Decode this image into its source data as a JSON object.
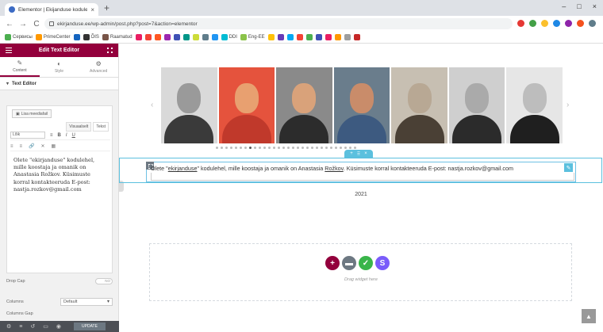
{
  "browser": {
    "tab_title": "Elementor | Ekijanduse kodulehe",
    "tab_close": "×",
    "new_tab": "+",
    "url": "ekirjanduse.ee/wp-admin/post.php?post=7&action=elementor",
    "back": "←",
    "forward": "→",
    "reload": "C",
    "window_controls": [
      "–",
      "□",
      "×"
    ],
    "extension_colors": [
      "#e53935",
      "#43a047",
      "#fbc02d",
      "#1e88e5",
      "#8e24aa",
      "#f4511e",
      "#607d8b"
    ]
  },
  "bookmarks": [
    {
      "label": "Сервисы",
      "color": "#4caf50"
    },
    {
      "label": "PrimeCenter",
      "color": "#ff9800"
    },
    {
      "label": "",
      "color": "#1565c0"
    },
    {
      "label": "ÕIS",
      "color": "#333333"
    },
    {
      "label": "Raamatud",
      "color": "#795548"
    },
    {
      "label": "",
      "color": "#e91e63"
    },
    {
      "label": "",
      "color": "#f44336"
    },
    {
      "label": "",
      "color": "#ff5722"
    },
    {
      "label": "",
      "color": "#9c27b0"
    },
    {
      "label": "",
      "color": "#3f51b5"
    },
    {
      "label": "",
      "color": "#009688"
    },
    {
      "label": "",
      "color": "#cddc39"
    },
    {
      "label": "",
      "color": "#607d8b"
    },
    {
      "label": "",
      "color": "#2196f3"
    },
    {
      "label": "DDI",
      "color": "#00bcd4"
    },
    {
      "label": "Eng-EE",
      "color": "#8bc34a"
    },
    {
      "label": "",
      "color": "#ffc107"
    },
    {
      "label": "",
      "color": "#673ab7"
    },
    {
      "label": "",
      "color": "#03a9f4"
    },
    {
      "label": "",
      "color": "#f44336"
    },
    {
      "label": "",
      "color": "#4caf50"
    },
    {
      "label": "",
      "color": "#3f51b5"
    },
    {
      "label": "",
      "color": "#e91e63"
    },
    {
      "label": "",
      "color": "#ff9800"
    },
    {
      "label": "",
      "color": "#9e9e9e"
    },
    {
      "label": "",
      "color": "#c62828"
    }
  ],
  "panel": {
    "title": "Edit Text Editor",
    "tabs": [
      {
        "label": "Content",
        "icon": "✎"
      },
      {
        "label": "Style",
        "icon": "◐"
      },
      {
        "label": "Advanced",
        "icon": "⚙"
      }
    ],
    "section": "Text Editor",
    "add_media": "Lisa meediafail",
    "mode_tabs": [
      "Visuaalselt",
      "Tekst"
    ],
    "format": "Lõik",
    "toolbar1": [
      "≡",
      "B",
      "I",
      "U"
    ],
    "toolbar2": [
      "≡",
      "≡",
      "🔗",
      "✕",
      "▦"
    ],
    "editor_text": "Olete \"ekirjanduse\" kodulehel, mille koostaja ja omanik on Anastasia Rožkov. Küsimuste korral kontakteeruda E-post: nastja.rozkov@gmail.com",
    "drop_cap_label": "Drop Cap",
    "drop_cap_value": "NO",
    "columns_label": "Columns",
    "columns_value": "Default",
    "columns_gap_label": "Columns Gap",
    "update_label": "UPDATE"
  },
  "preview": {
    "gallery": [
      {
        "name": "portrait-1",
        "head": "#9a9a9a",
        "body": "#3a3a3a",
        "bg": "#d9d9d9"
      },
      {
        "name": "portrait-2",
        "head": "#e8a070",
        "body": "#c0392b",
        "bg": "#e5533d"
      },
      {
        "name": "portrait-3",
        "head": "#d9a27a",
        "body": "#2c2c2c",
        "bg": "#8a8a8a"
      },
      {
        "name": "portrait-4",
        "head": "#c98c6a",
        "body": "#3d5a80",
        "bg": "#6a7d8c"
      },
      {
        "name": "portrait-5",
        "head": "#b8a894",
        "body": "#4a4035",
        "bg": "#c7bfb2"
      },
      {
        "name": "portrait-6",
        "head": "#aaaaaa",
        "body": "#2b2b2b",
        "bg": "#cfcfcf"
      },
      {
        "name": "portrait-7",
        "head": "#bdbdbd",
        "body": "#1f1f1f",
        "bg": "#e6e6e6"
      }
    ],
    "arrow_left": "‹",
    "arrow_right": "›",
    "dot_count": 30,
    "active_dot": 7,
    "text_before": "Olete \"",
    "text_link1": "ekirjanduse",
    "text_mid": "\" kodulehel, mille koostaja ja omanik on Anastasia ",
    "text_link2": "Rožkov",
    "text_after": ". Küsimuste korral kontakteeruda E-post: nastja.rozkov@gmail.com",
    "year": "2021",
    "dropzone_text": "Drag widget here",
    "dz_buttons": [
      {
        "icon": "+",
        "color": "#93003c"
      },
      {
        "icon": "▬",
        "color": "#6d7882"
      },
      {
        "icon": "✓",
        "color": "#39b54a"
      },
      {
        "icon": "S",
        "color": "#7a5cfa"
      }
    ],
    "scroll_top": "▲"
  }
}
